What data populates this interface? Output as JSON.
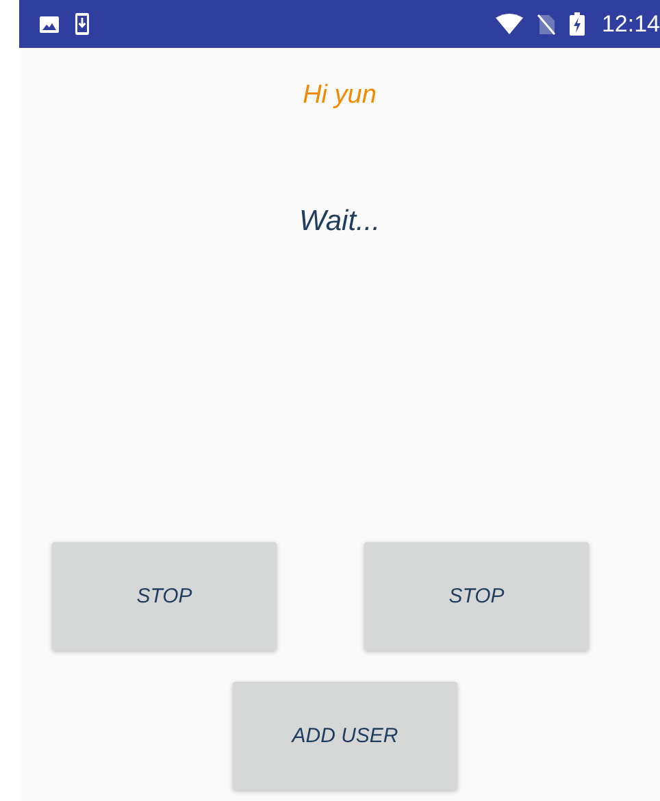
{
  "status_bar": {
    "time": "12:14"
  },
  "greeting": "Hi yun",
  "message": "Wait...",
  "buttons": [
    {
      "label": "STOP"
    },
    {
      "label": "STOP"
    },
    {
      "label": "ADD USER"
    }
  ]
}
